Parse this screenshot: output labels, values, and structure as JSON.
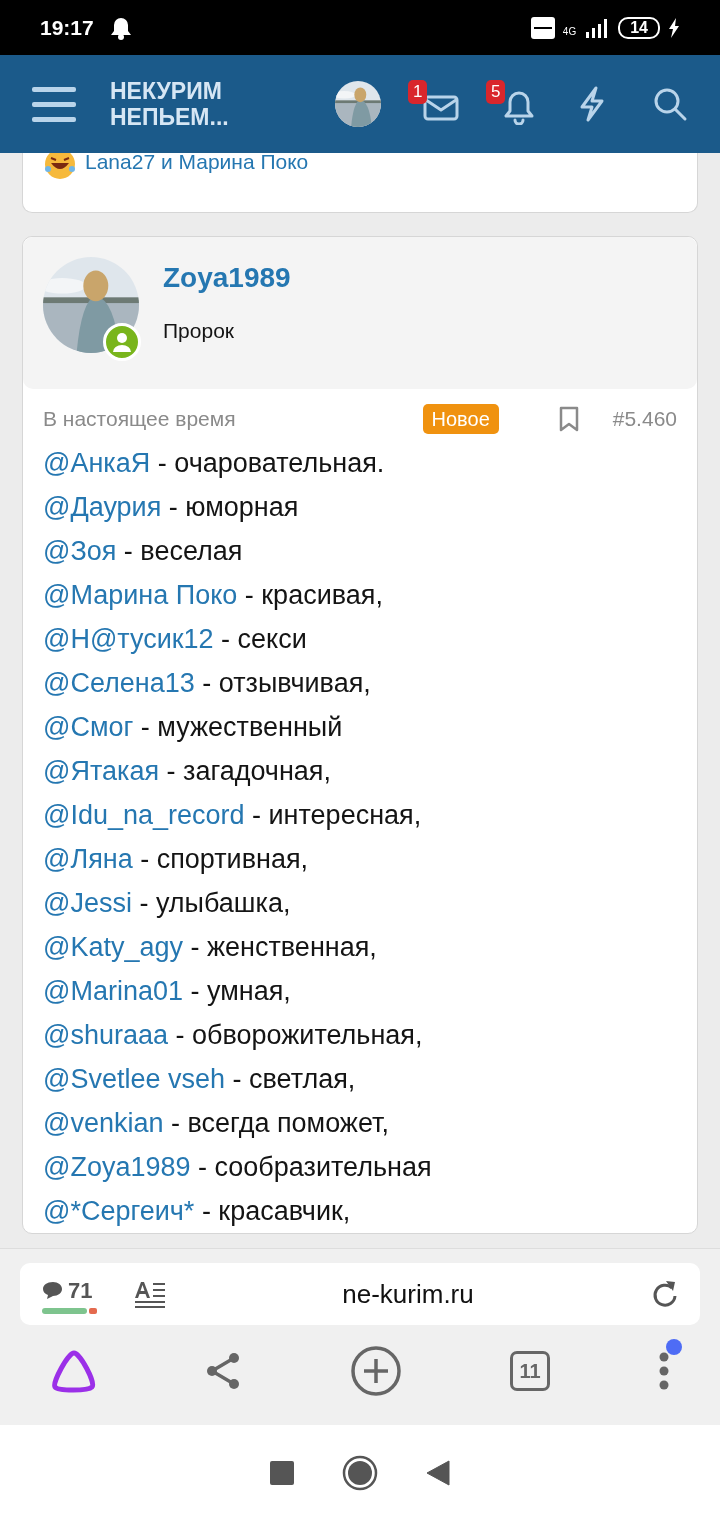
{
  "status_bar": {
    "time": "19:17",
    "network": "4G",
    "battery": "14"
  },
  "header": {
    "logo": [
      "НЕКУРИМ",
      "НЕПЬЕМ..."
    ],
    "messages_count": "1",
    "alerts_count": "5"
  },
  "previous_post": {
    "reactions": "Lana27 и Марина Поко"
  },
  "post": {
    "author": "Zoya1989",
    "user_title": "Пророк",
    "online": true,
    "time": "В настоящее время",
    "badge": "Новое",
    "number": "#5.460",
    "lines": [
      {
        "mention": "@АнкаЯ",
        "text": "- очаровательная."
      },
      {
        "mention": "@Даурия",
        "text": "- юморная"
      },
      {
        "mention": "@Зоя",
        "text": "- веселая"
      },
      {
        "mention": "@Марина Поко",
        "text": "- красивая,"
      },
      {
        "mention": "@Н@тусик12",
        "text": "- секси"
      },
      {
        "mention": "@Селена13",
        "text": "- отзывчивая,"
      },
      {
        "mention": "@Смог",
        "text": "- мужественный"
      },
      {
        "mention": "@Ятакая",
        "text": "- загадочная,"
      },
      {
        "mention": "@Idu_na_record",
        "text": "- интересная,"
      },
      {
        "mention": "@Ляна",
        "text": "- спортивная,"
      },
      {
        "mention": "@Jessi",
        "text": "- улыбашка,"
      },
      {
        "mention": "@Katy_agy",
        "text": "- женственная,"
      },
      {
        "mention": "@Marina01",
        "text": "- умная,"
      },
      {
        "mention": "@shuraaa",
        "text": "- обворожительная,"
      },
      {
        "mention": "@Svetlee vseh",
        "text": "- светлая,"
      },
      {
        "mention": "@venkian",
        "text": "- всегда поможет,"
      },
      {
        "mention": "@Zoya1989",
        "text": "- сообразительная"
      },
      {
        "mention": "@*Сергеич*",
        "text": "- красавчик,"
      }
    ]
  },
  "browser": {
    "comments_count": "71",
    "url": "ne-kurim.ru",
    "tabs_count": "11",
    "menu_notification": true
  }
}
